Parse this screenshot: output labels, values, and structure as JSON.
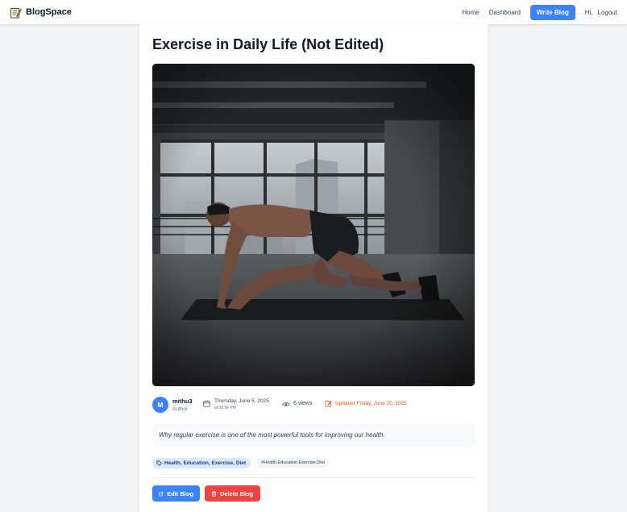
{
  "nav": {
    "brand": "BlogSpace",
    "home": "Home",
    "dashboard": "Dashboard",
    "write": "Write Blog",
    "greeting": "Hi,",
    "logout": "Logout"
  },
  "post": {
    "title": "Exercise in Daily Life (Not Edited)",
    "image_alt": "Man doing a mountain-climber exercise on a mat in an industrial room",
    "author": {
      "initial": "M",
      "name": "mithu3",
      "role": "Author"
    },
    "date": "Thursday, June 5, 2025",
    "time": "at 06:56 PM",
    "views": "6 views",
    "updated": "Updated Friday, June 20, 2025",
    "excerpt": "Why regular exercise is one of the most powerful tools for improving our health.",
    "categories": "Health, Education, Exercise, Diet",
    "tags": "#Health,Education,Exercise,Diet"
  },
  "actions": {
    "edit": "Edit Blog",
    "delete": "Delete Blog"
  },
  "colors": {
    "primary": "#3b82f6",
    "danger": "#ef4444",
    "updated": "#ea580c"
  }
}
